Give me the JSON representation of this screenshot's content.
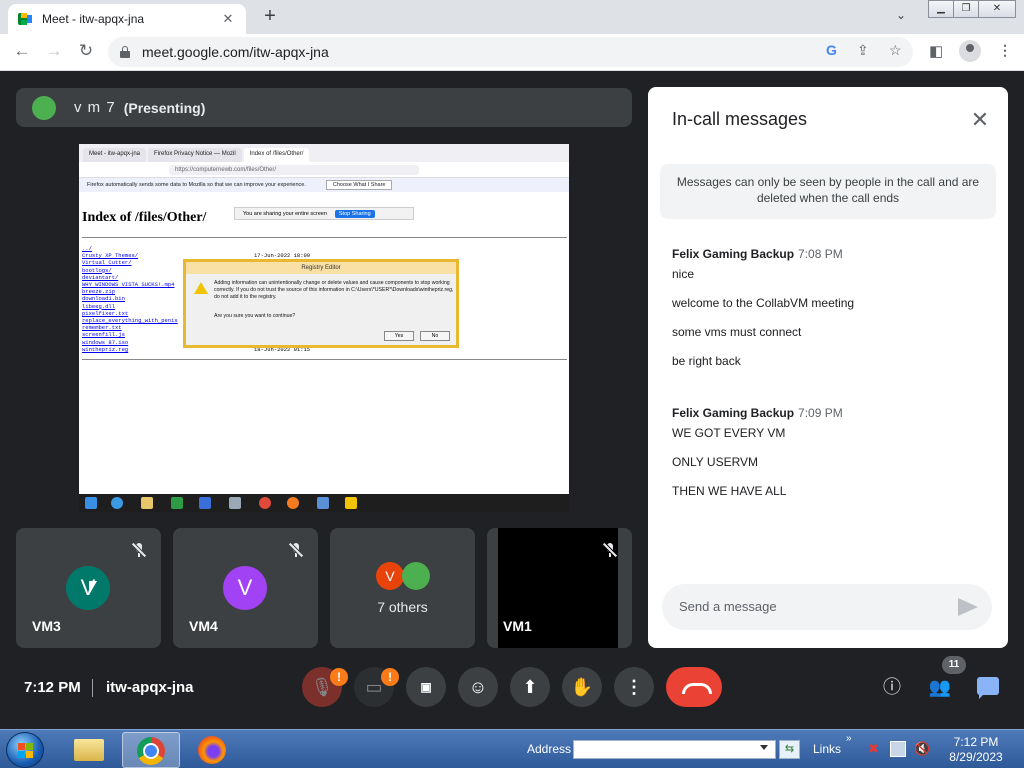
{
  "browser": {
    "tab_title": "Meet - itw-apqx-jna",
    "url": "meet.google.com/itw-apqx-jna"
  },
  "presenter": {
    "name": "v m 7",
    "tag": "(Presenting)"
  },
  "shared_screen": {
    "tabs": [
      "Meet - itw-apqx-jna",
      "Firefox Privacy Notice — Mozil",
      "Index of /files/Other/"
    ],
    "url": "https://computernewb.com/files/Other/",
    "notice": "Firefox automatically sends some data to Mozilla so that we can improve your experience.",
    "notice_button": "Choose What I Share",
    "sharing_text": "You are sharing your entire screen",
    "stop_sharing": "Stop Sharing",
    "heading": "Index of /files/Other/",
    "links": [
      "../",
      "Crusty XP Themes/",
      "Virtual Cutter/",
      "bootlogs/",
      "deviantart/",
      "WHY WINDOWS VISTA SUCKS!.mp4",
      "breeze.zip",
      "download1.bin",
      "libeeg.dll",
      "pixelfixer.txt",
      "replace_everything_with_penis",
      "remember.txt",
      "screenfill.js",
      "windows 87.iso",
      "winthepriz.reg"
    ],
    "first_date": "17-Jun-2022 18:09",
    "last_date": "18-Jun-2022 01:15",
    "dialog_title": "Registry Editor",
    "dialog_text": "Adding information can unintentionally change or delete values and cause components to stop working correctly. If you do not trust the source of this information in C:\\Users\\*USER*\\Downloads\\winthepriz.reg, do not add it to the registry.",
    "dialog_question": "Are you sure you want to continue?",
    "yes": "Yes",
    "no": "No"
  },
  "tiles": [
    {
      "name": "VM3",
      "initial": "V",
      "color": "#00796b"
    },
    {
      "name": "VM4",
      "initial": "V",
      "color": "#a142f4"
    },
    {
      "others_label": "7 others",
      "initial": "V",
      "color": "#e8430a",
      "second_color": "#4caf50"
    },
    {
      "name": "VM1"
    }
  ],
  "chat": {
    "title": "In-call messages",
    "notice": "Messages can only be seen by people in the call and are deleted when the call ends",
    "groups": [
      {
        "sender": "Felix Gaming Backup",
        "time": "7:08 PM",
        "messages": [
          "nice",
          "welcome to the CollabVM meeting",
          "some vms must connect",
          "be right back"
        ]
      },
      {
        "sender": "Felix Gaming Backup",
        "time": "7:09 PM",
        "messages": [
          "WE GOT EVERY VM",
          "ONLY USERVM",
          "THEN WE HAVE ALL"
        ]
      }
    ],
    "input_placeholder": "Send a message"
  },
  "controls": {
    "time": "7:12 PM",
    "meeting_code": "itw-apqx-jna",
    "people_count": "11",
    "warn_mark": "!"
  },
  "taskbar": {
    "address_label": "Address",
    "links_label": "Links",
    "time": "7:12 PM",
    "date": "8/29/2023"
  },
  "colors": {
    "meet_background": "#202124",
    "tile_background": "#3c4043",
    "hangup_red": "#ea4335",
    "warning_orange": "#fa7b17"
  }
}
